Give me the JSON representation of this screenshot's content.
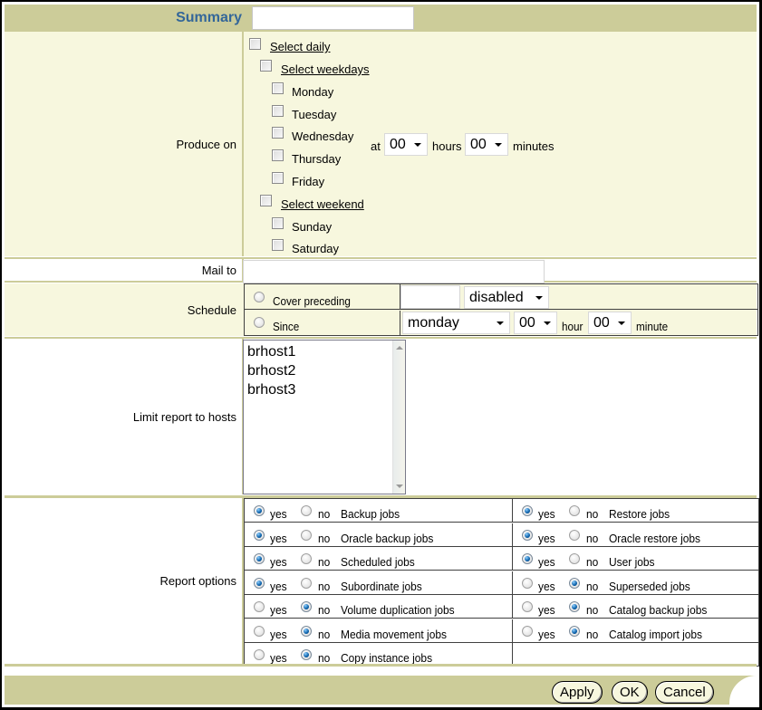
{
  "summary": {
    "label": "Summary",
    "value": "",
    "placeholder": ""
  },
  "produce_on": {
    "label": "Produce on",
    "select_daily": {
      "label": "Select daily",
      "checked": false
    },
    "select_weekdays": {
      "label": "Select weekdays",
      "checked": false
    },
    "weekdays": [
      {
        "label": "Monday",
        "checked": false
      },
      {
        "label": "Tuesday",
        "checked": false
      },
      {
        "label": "Wednesday",
        "checked": false
      },
      {
        "label": "Thursday",
        "checked": false
      },
      {
        "label": "Friday",
        "checked": false
      }
    ],
    "select_weekend": {
      "label": "Select weekend",
      "checked": false
    },
    "weekend": [
      {
        "label": "Sunday",
        "checked": false
      },
      {
        "label": "Saturday",
        "checked": false
      }
    ],
    "at_label": "at",
    "hours_value": "00",
    "hours_label": "hours",
    "minutes_value": "00",
    "minutes_label": "minutes"
  },
  "mail_to": {
    "label": "Mail to",
    "value": ""
  },
  "schedule": {
    "label": "Schedule",
    "cover_preceding": {
      "label": "Cover preceding",
      "selected": false,
      "amount_value": "",
      "unit_value": "disabled"
    },
    "since": {
      "label": "Since",
      "selected": false,
      "day_value": "monday",
      "hour_value": "00",
      "hour_label": "hour",
      "minute_value": "00",
      "minute_label": "minute"
    }
  },
  "hosts": {
    "label": "Limit report to hosts",
    "items": [
      "brhost1",
      "brhost2",
      "brhost3"
    ]
  },
  "report_options": {
    "label": "Report options",
    "yes_label": "yes",
    "no_label": "no",
    "rows": [
      {
        "left": {
          "label": "Backup jobs",
          "value": "yes"
        },
        "right": {
          "label": "Restore jobs",
          "value": "yes"
        }
      },
      {
        "left": {
          "label": "Oracle backup jobs",
          "value": "yes"
        },
        "right": {
          "label": "Oracle restore jobs",
          "value": "yes"
        }
      },
      {
        "left": {
          "label": "Scheduled jobs",
          "value": "yes"
        },
        "right": {
          "label": "User jobs",
          "value": "yes"
        }
      },
      {
        "left": {
          "label": "Subordinate jobs",
          "value": "yes"
        },
        "right": {
          "label": "Superseded jobs",
          "value": "no"
        }
      },
      {
        "left": {
          "label": "Volume duplication jobs",
          "value": "no"
        },
        "right": {
          "label": "Catalog backup jobs",
          "value": "no"
        }
      },
      {
        "left": {
          "label": "Media movement jobs",
          "value": "no"
        },
        "right": {
          "label": "Catalog import jobs",
          "value": "no"
        }
      },
      {
        "left": {
          "label": "Copy instance jobs",
          "value": "no"
        },
        "right": null
      }
    ]
  },
  "footer": {
    "apply_label": "Apply",
    "ok_label": "OK",
    "cancel_label": "Cancel"
  },
  "colors": {
    "header_bg": "#cccc99",
    "row_bg_tint": "#f7f7de",
    "summary_label": "#336699",
    "radio_selected": "#0a5fa8"
  }
}
